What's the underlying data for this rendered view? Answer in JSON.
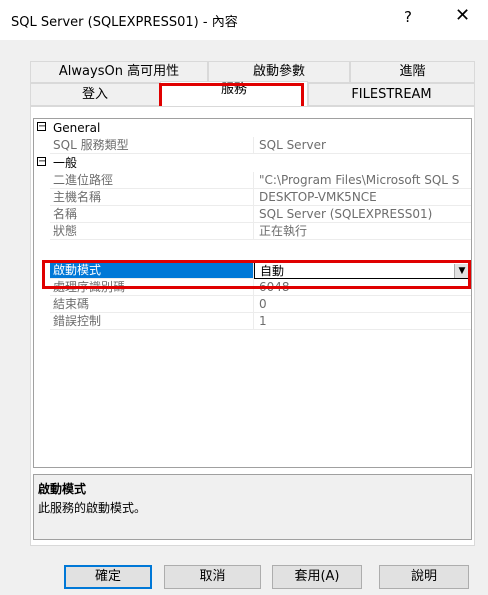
{
  "window": {
    "title": "SQL Server (SQLEXPRESS01) - 內容",
    "help_glyph": "?",
    "close_glyph": "✕"
  },
  "tabs": {
    "row1": [
      "AlwaysOn 高可用性",
      "啟動參數",
      "進階"
    ],
    "row2": [
      "登入",
      "服務",
      "FILESTREAM"
    ],
    "selected": "服務"
  },
  "grid": {
    "categories": [
      {
        "label": "General",
        "toggle": "−",
        "rows": [
          {
            "name": "SQL 服務類型",
            "value": "SQL Server"
          }
        ]
      },
      {
        "label": "一般",
        "toggle": "−",
        "rows": [
          {
            "name": "二進位路徑",
            "value": "\"C:\\Program Files\\Microsoft SQL S"
          },
          {
            "name": "主機名稱",
            "value": "DESKTOP-VMK5NCE"
          },
          {
            "name": "名稱",
            "value": "SQL Server (SQLEXPRESS01)"
          },
          {
            "name": "狀態",
            "value": "正在執行"
          },
          {
            "name": "啟動模式",
            "value": "自動"
          },
          {
            "name": "處理序識別碼",
            "value": "6048"
          },
          {
            "name": "結束碼",
            "value": "0"
          },
          {
            "name": "錯誤控制",
            "value": "1"
          }
        ]
      }
    ],
    "dropdown_glyph": "▼"
  },
  "description": {
    "title": "啟動模式",
    "text": "此服務的啟動模式。"
  },
  "buttons": {
    "ok": "確定",
    "cancel": "取消",
    "apply": "套用(A)",
    "help": "說明"
  },
  "highlight_color": "#e00000",
  "selection_color": "#0078d7"
}
